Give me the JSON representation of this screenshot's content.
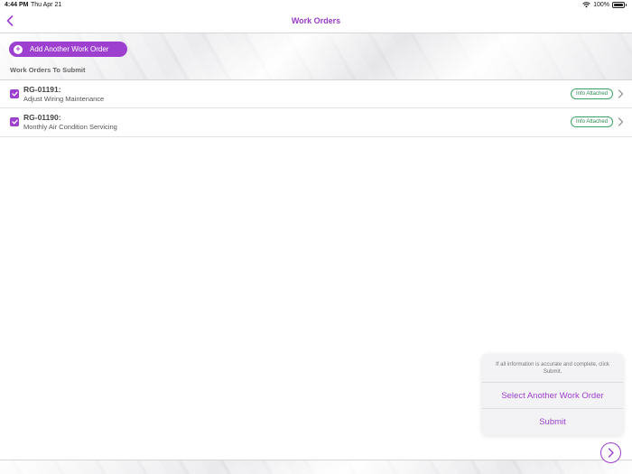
{
  "status_bar": {
    "time": "4:44 PM",
    "date": "Thu Apr 21",
    "battery": "100%"
  },
  "nav": {
    "title": "Work Orders"
  },
  "banner": {
    "add_button_label": "Add Another Work Order",
    "section_label": "Work Orders To Submit"
  },
  "work_orders": [
    {
      "id": "RG-01191:",
      "description": "Adjust Wiring Maintenance",
      "badge": "Info Attached"
    },
    {
      "id": "RG-01190:",
      "description": "Monthly Air Condition Servicing",
      "badge": "Info Attached"
    }
  ],
  "popup": {
    "message": "If all information is accurate and complete, click Submit.",
    "select_label": "Select Another Work Order",
    "submit_label": "Submit"
  },
  "colors": {
    "accent": "#9d3fcf",
    "badge": "#2f8b53"
  }
}
